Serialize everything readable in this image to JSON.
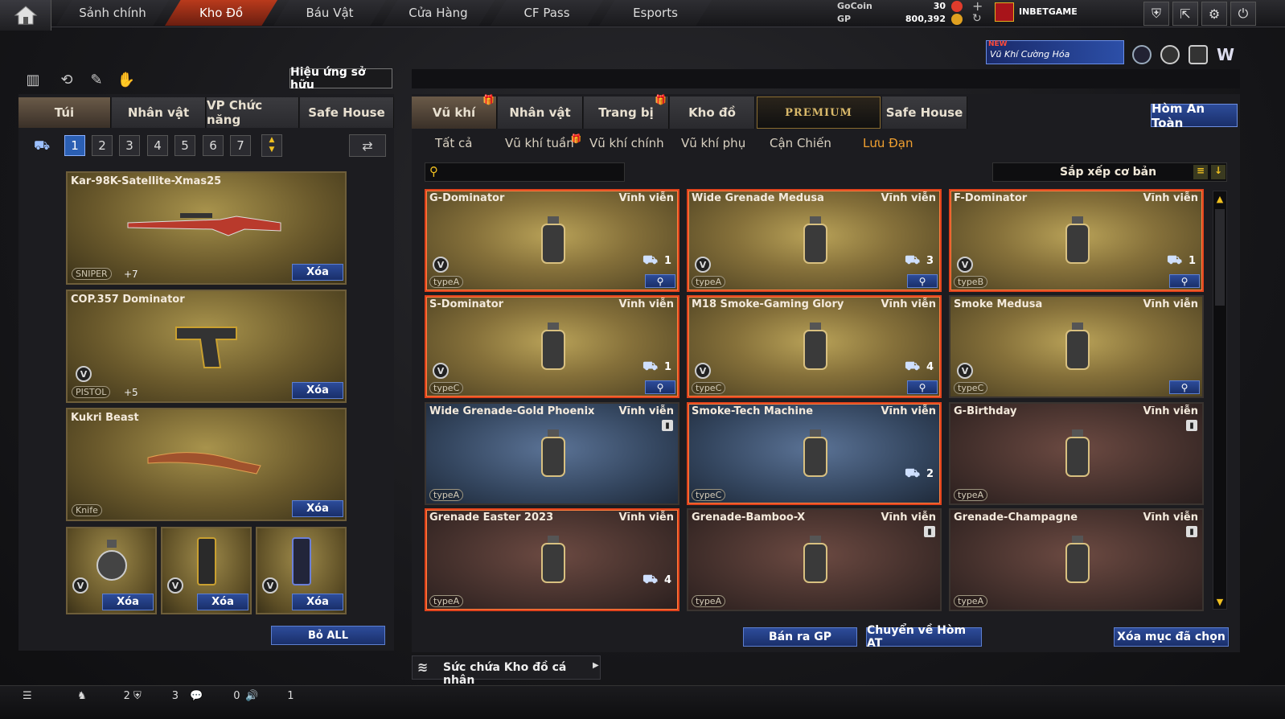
{
  "nav": {
    "tabs": [
      {
        "label": "Sảnh chính"
      },
      {
        "label": "Kho Đồ"
      },
      {
        "label": "Báu Vật"
      },
      {
        "label": "Cửa Hàng"
      },
      {
        "label": "CF Pass"
      },
      {
        "label": "Esports"
      }
    ],
    "active_index": 1
  },
  "currency": {
    "gocoin_label": "GoCoin",
    "gocoin_value": "30",
    "gp_label": "GP",
    "gp_value": "800,392"
  },
  "user": {
    "name": "INBETGAME"
  },
  "banner": {
    "badge": "NEW",
    "text": "Vũ Khí Cường Hóa"
  },
  "left": {
    "effect_button": "Hiệu ứng sở hữu",
    "tabs": [
      {
        "label": "Túi"
      },
      {
        "label": "Nhân vật"
      },
      {
        "label": "VP Chức năng"
      },
      {
        "label": "Safe House"
      }
    ],
    "pages": [
      "1",
      "2",
      "3",
      "4",
      "5",
      "6",
      "7"
    ],
    "active_page": "1",
    "equipped": [
      {
        "name": "Kar-98K-Satellite-Xmas25",
        "type": "SNIPER",
        "ammo": "+7",
        "delete": "Xóa"
      },
      {
        "name": "COP.357 Dominator",
        "type": "PISTOL",
        "ammo": "+5",
        "delete": "Xóa"
      },
      {
        "name": "Kukri Beast",
        "type": "Knife",
        "delete": "Xóa"
      }
    ],
    "grenade_slots": [
      {
        "delete": "Xóa"
      },
      {
        "delete": "Xóa"
      },
      {
        "delete": "Xóa"
      }
    ],
    "remove_all": "Bỏ ALL"
  },
  "right": {
    "tabs": [
      {
        "label": "Vũ khí",
        "gift": true
      },
      {
        "label": "Nhân vật"
      },
      {
        "label": "Trang bị",
        "gift": true
      },
      {
        "label": "Kho đồ"
      },
      {
        "label": "PREMIUM"
      },
      {
        "label": "Safe House"
      }
    ],
    "safe_box_button": "Hòm An Toàn",
    "subtabs": [
      {
        "label": "Tất cả"
      },
      {
        "label": "Vũ khí tuần",
        "gift": true
      },
      {
        "label": "Vũ khí chính"
      },
      {
        "label": "Vũ khí phụ"
      },
      {
        "label": "Cận Chiến"
      },
      {
        "label": "Lưu Đạn"
      }
    ],
    "active_subtab": "Lưu Đạn",
    "search": {
      "placeholder": ""
    },
    "sort": {
      "label": "Sắp xếp cơ bản"
    },
    "items": [
      {
        "name": "G-Dominator",
        "duration": "Vĩnh viễn",
        "type": "typeA",
        "qty": "1",
        "style": "gold",
        "selected": true,
        "v": true,
        "zoom": true
      },
      {
        "name": "Wide Grenade Medusa",
        "duration": "Vĩnh viễn",
        "type": "typeA",
        "qty": "3",
        "style": "gold",
        "selected": true,
        "v": true,
        "zoom": true
      },
      {
        "name": "F-Dominator",
        "duration": "Vĩnh viễn",
        "type": "typeB",
        "qty": "1",
        "style": "gold",
        "selected": true,
        "v": true,
        "zoom": true
      },
      {
        "name": "S-Dominator",
        "duration": "Vĩnh viễn",
        "type": "typeC",
        "qty": "1",
        "style": "gold",
        "selected": true,
        "v": true,
        "zoom": true
      },
      {
        "name": "M18 Smoke-Gaming Glory",
        "duration": "Vĩnh viễn",
        "type": "typeC",
        "qty": "4",
        "style": "gold",
        "selected": true,
        "v": true,
        "zoom": true
      },
      {
        "name": "Smoke Medusa",
        "duration": "Vĩnh viễn",
        "type": "typeC",
        "qty": "",
        "style": "gold",
        "selected": false,
        "v": true,
        "zoom": true
      },
      {
        "name": "Wide Grenade-Gold Phoenix",
        "duration": "Vĩnh viễn",
        "type": "typeA",
        "qty": "",
        "style": "blue",
        "selected": false,
        "trash": true
      },
      {
        "name": "Smoke-Tech Machine",
        "duration": "Vĩnh viễn",
        "type": "typeC",
        "qty": "2",
        "style": "blue",
        "selected": true
      },
      {
        "name": "G-Birthday",
        "duration": "Vĩnh viễn",
        "type": "typeA",
        "qty": "",
        "style": "brown",
        "selected": false,
        "trash": true
      },
      {
        "name": "Grenade Easter 2023",
        "duration": "Vĩnh viễn",
        "type": "typeA",
        "qty": "4",
        "style": "brown",
        "selected": true
      },
      {
        "name": "Grenade-Bamboo-X",
        "duration": "Vĩnh viễn",
        "type": "typeA",
        "qty": "",
        "style": "brown",
        "selected": false,
        "trash": true
      },
      {
        "name": "Grenade-Champagne",
        "duration": "Vĩnh viễn",
        "type": "typeA",
        "qty": "",
        "style": "brown",
        "selected": false,
        "trash": true
      }
    ],
    "sell_button": "Bán ra GP",
    "transfer_button": "Chuyển về Hòm AT",
    "delete_selected_button": "Xóa mục đã chọn",
    "capacity_label": "Sức chứa Kho đồ cá nhân"
  },
  "status": {
    "friends": "2",
    "clan": "3",
    "chat": "0",
    "voice": "1"
  },
  "colors": {
    "accent": "#2b5fb3",
    "active_tab": "#b93a1c",
    "selected_border": "#e0431c",
    "subtab_active": "#f0a030"
  }
}
